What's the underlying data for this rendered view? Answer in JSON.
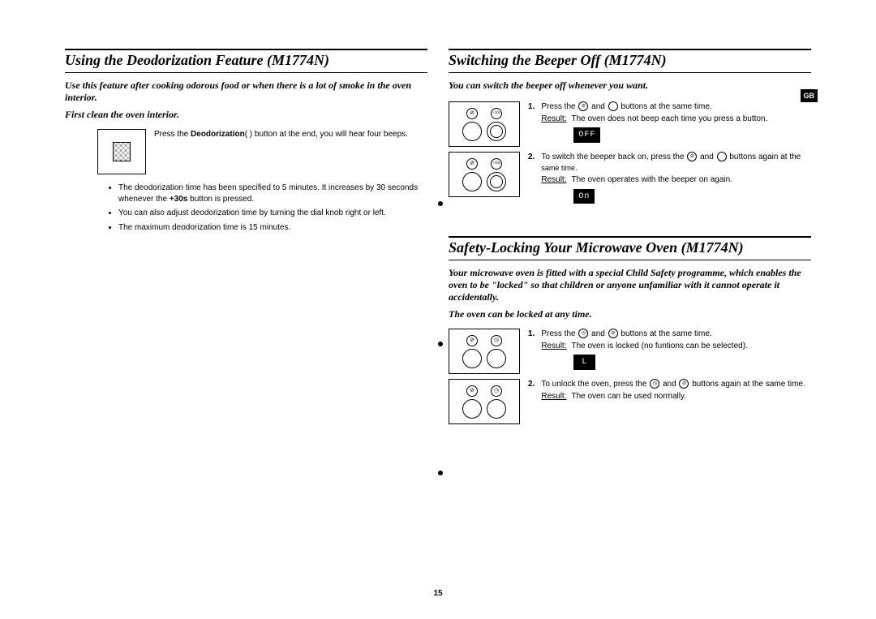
{
  "page_number": "15",
  "region_badge": "GB",
  "left": {
    "title": "Using the Deodorization Feature (M1774N)",
    "intro": "Use this feature after cooking odorous food or when there is a lot of smoke in the oven interior.",
    "intro2": "First clean the oven interior.",
    "step_prefix": "Press the ",
    "step_bold": "Deodorization",
    "step_suffix": "(  ) button at the end, you will hear four beeps.",
    "bullets": [
      {
        "a": "The deodorization time has been specified to 5 minutes. It increases by 30 seconds whenever the ",
        "b": "+30s",
        "c": " button is pressed."
      },
      {
        "a": "You can also adjust deodorization time by turning the dial knob right or left.",
        "b": "",
        "c": ""
      },
      {
        "a": "The maximum deodorization time is 15 minutes.",
        "b": "",
        "c": ""
      }
    ]
  },
  "right_top": {
    "title": "Switching the Beeper Off (M1774N)",
    "intro": "You can switch the beeper off whenever you want.",
    "step1": {
      "num": "1.",
      "a": "Press the ",
      "b": " and ",
      "c": " buttons at the same time.",
      "result_label": "Result:",
      "result": "The oven does not beep each time you press a button.",
      "lcd": "OFF"
    },
    "step2": {
      "num": "2.",
      "a": "To switch the beeper back on, press the ",
      "b": " and ",
      "c": " buttons again at the ",
      "d": "same time",
      "e": ".",
      "result_label": "Result:",
      "result": "The oven operates with the beeper on again.",
      "lcd": "On"
    }
  },
  "right_bottom": {
    "title": "Safety-Locking Your Microwave Oven (M1774N)",
    "intro": "Your microwave oven is fitted with a special Child Safety programme, which enables the oven to be \"locked\" so that children or anyone unfamiliar with it cannot operate it accidentally.",
    "intro2": "The oven can be locked at any time.",
    "step1": {
      "num": "1.",
      "a": "Press the ",
      "b": " and ",
      "c": " buttons at the same time.",
      "result_label": "Result:",
      "result": "The oven is locked (no funtions can be selected).",
      "lcd": "L"
    },
    "step2": {
      "num": "2.",
      "a": "To unlock the oven, press the ",
      "b": " and ",
      "c": " buttons again at the same time.",
      "result_label": "Result:",
      "result": "The oven can be used normally."
    }
  }
}
